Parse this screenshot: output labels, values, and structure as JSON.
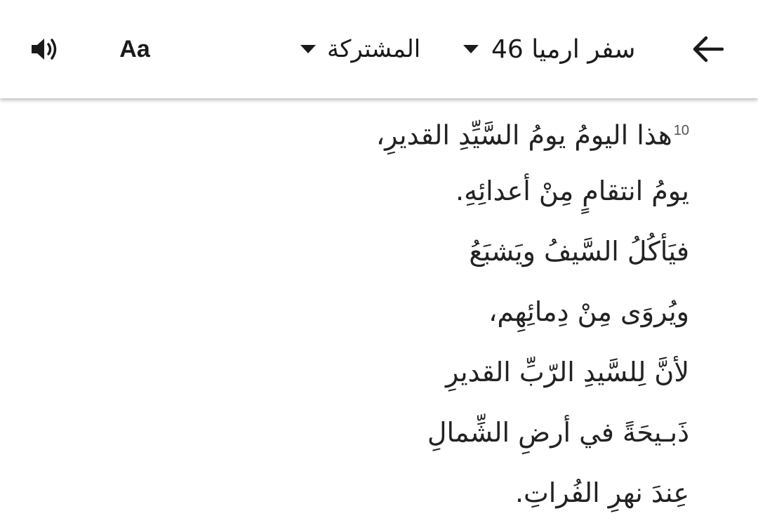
{
  "header": {
    "book_chapter": "سفر ارميا 46",
    "version": "المشتركة",
    "font_label": "Aa",
    "icons": {
      "back": "arrow-left-icon",
      "book_dropdown": "caret-down-icon",
      "version_dropdown": "caret-down-icon",
      "audio": "speaker-icon"
    }
  },
  "passage": {
    "verse_number": "10",
    "lines": [
      "هذا اليومُ يومُ السَّيِّدِ القديرِ،",
      "يومُ انتقامٍ مِنْ أعدائِهِ.",
      "فيَأكُلُ السَّيفُ ويَشبَعُ",
      "ويُروَى مِنْ دِمائِهِم،",
      "لأنَّ لِلسَّيدِ الرّبِّ القديرِ",
      "ذَبـيحَةً في أرضِ الشِّمالِ",
      "عِندَ نهرِ الفُراتِ."
    ]
  },
  "colors": {
    "text": "#222222",
    "icon": "#1a1a1a",
    "verse_number": "#555555",
    "background": "#ffffff"
  }
}
